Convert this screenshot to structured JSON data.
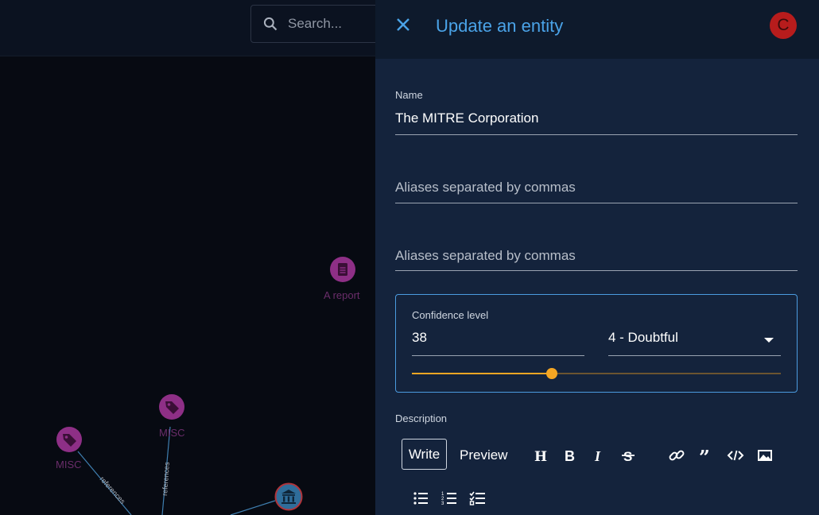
{
  "search": {
    "placeholder": "Search..."
  },
  "graph": {
    "nodes": [
      {
        "label": "A report",
        "icon": "report-icon"
      },
      {
        "label": "MISC",
        "icon": "tag-icon"
      },
      {
        "label": "MISC",
        "icon": "tag-icon"
      },
      {
        "label": "",
        "icon": "organization-icon"
      }
    ],
    "edges": [
      {
        "label": "references"
      },
      {
        "label": "references"
      }
    ]
  },
  "panel": {
    "title": "Update an entity",
    "avatar_initial": "C",
    "name_label": "Name",
    "name_value": "The MITRE Corporation",
    "aliases_placeholder_1": "Aliases separated by commas",
    "aliases_placeholder_2": "Aliases separated by commas",
    "confidence": {
      "label": "Confidence level",
      "value": "38",
      "level": "4 - Doubtful",
      "slider_value": 38,
      "slider_max": 100
    },
    "description_label": "Description",
    "editor": {
      "write_label": "Write",
      "preview_label": "Preview"
    }
  },
  "colors": {
    "accent": "#4aa3e8",
    "slider": "#f5a623",
    "node_purple": "#8e2f86",
    "avatar": "#b71c1c"
  }
}
